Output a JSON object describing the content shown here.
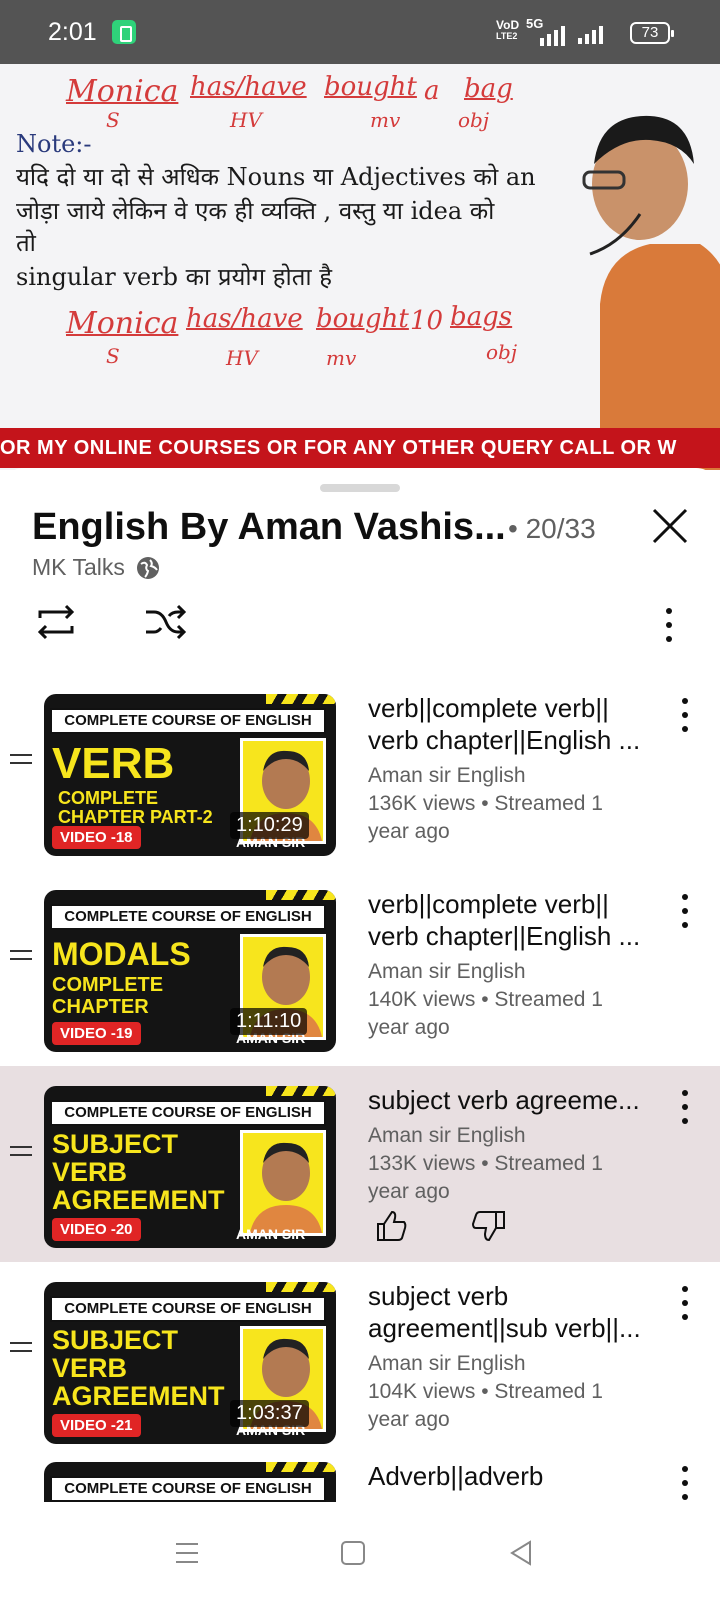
{
  "status_bar": {
    "time": "2:01",
    "network_label_top": "VoD",
    "network_label_bottom": "LTE2",
    "network_5g": "5G",
    "battery": "73"
  },
  "video": {
    "note_label": "Note:-",
    "line1": "यदि दो या दो से अधिक Nouns या Adjectives को an",
    "line2": "जोड़ा जाये लेकिन वे एक ही व्यक्ति , वस्तु या idea को",
    "line3": "तो",
    "line4": "singular verb का प्रयोग  होता है",
    "hw_top": [
      "Monica",
      "has/have",
      "bought",
      "a",
      "bag"
    ],
    "hw_top_sub": [
      "S",
      "HV",
      "mv",
      "obj"
    ],
    "hw_bottom": [
      "Monica",
      "has/have",
      "bought",
      "10",
      "bags"
    ],
    "hw_bottom_sub": [
      "S",
      "HV",
      "mv",
      "obj"
    ],
    "ticker": "OR MY ONLINE COURSES OR FOR ANY OTHER QUERY CALL OR W"
  },
  "playlist": {
    "title": "English By Aman Vashis...",
    "count": "• 20/33",
    "channel": "MK Talks",
    "items": [
      {
        "head": "COMPLETE COURSE OF ENGLISH",
        "big": [
          "VERB"
        ],
        "sub": [
          "COMPLETE",
          "CHAPTER PART-2"
        ],
        "tag": "VIDEO -18",
        "duration": "1:10:29",
        "aman": "AMAN SIR",
        "title1": "verb||complete verb||",
        "title2": "verb chapter||English ...",
        "channel": "Aman sir English",
        "meta1": "136K views • Streamed 1",
        "meta2": "year ago"
      },
      {
        "head": "COMPLETE COURSE OF ENGLISH",
        "big": [
          "MODALS"
        ],
        "sub": [
          "COMPLETE",
          "CHAPTER"
        ],
        "tag": "VIDEO -19",
        "duration": "1:11:10",
        "aman": "AMAN SIR",
        "title1": "verb||complete verb||",
        "title2": "verb chapter||English ...",
        "channel": "Aman sir English",
        "meta1": "140K views • Streamed 1",
        "meta2": "year ago"
      },
      {
        "head": "COMPLETE COURSE OF ENGLISH",
        "big": [
          "SUBJECT",
          "VERB",
          "AGREEMENT"
        ],
        "tag": "VIDEO -20",
        "aman": "AMAN SIR",
        "title1": "subject verb agreeme...",
        "channel": "Aman sir English",
        "meta1": "133K views • Streamed 1",
        "meta2": "year ago"
      },
      {
        "head": "COMPLETE COURSE OF ENGLISH",
        "big": [
          "SUBJECT",
          "VERB",
          "AGREEMENT"
        ],
        "tag": "VIDEO -21",
        "duration": "1:03:37",
        "aman": "AMAN SIR",
        "title1": "subject verb",
        "title2": "agreement||sub verb||...",
        "channel": "Aman sir English",
        "meta1": "104K views • Streamed 1",
        "meta2": "year ago"
      },
      {
        "head": "COMPLETE COURSE OF ENGLISH",
        "title1": "Adverb||adverb"
      }
    ]
  }
}
